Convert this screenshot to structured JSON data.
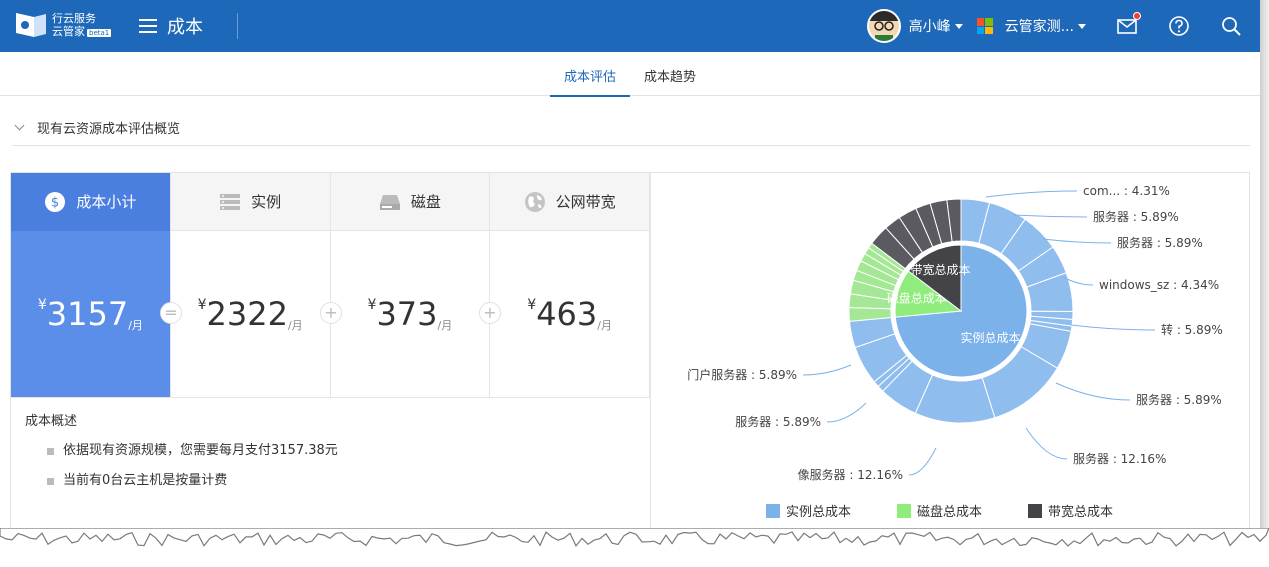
{
  "header": {
    "logo_line1": "行云服务",
    "logo_line2": "云管家",
    "logo_badge": "beta1",
    "page_title": "成本",
    "user_name": "高小峰",
    "tenant_name": "云管家测...",
    "icons": [
      "menu-icon",
      "mail-icon",
      "help-icon",
      "search-icon"
    ]
  },
  "tabs": [
    {
      "label": "成本评估",
      "active": true
    },
    {
      "label": "成本趋势",
      "active": false
    }
  ],
  "section": {
    "title": "现有云资源成本评估概览"
  },
  "metrics": [
    {
      "label": "成本小计",
      "currency": "¥",
      "value": "3157",
      "unit": "/月",
      "icon": "dollar-icon",
      "active": true
    },
    {
      "label": "实例",
      "currency": "¥",
      "value": "2322",
      "unit": "/月",
      "icon": "server-icon",
      "active": false
    },
    {
      "label": "磁盘",
      "currency": "¥",
      "value": "373",
      "unit": "/月",
      "icon": "disk-icon",
      "active": false
    },
    {
      "label": "公网带宽",
      "currency": "¥",
      "value": "463",
      "unit": "/月",
      "icon": "globe-icon",
      "active": false
    }
  ],
  "operators": [
    "=",
    "+",
    "+"
  ],
  "summary": {
    "title": "成本概述",
    "items": [
      "依据现有资源规模，您需要每月支付3157.38元",
      "当前有0台云主机是按量计费"
    ]
  },
  "chart_data": {
    "type": "pie",
    "inner": [
      {
        "name": "实例总成本",
        "value": 2322,
        "color": "#7cb2ea"
      },
      {
        "name": "磁盘总成本",
        "value": 373,
        "color": "#90ed7d"
      },
      {
        "name": "带宽总成本",
        "value": 463,
        "color": "#434348"
      }
    ],
    "outer_labels": [
      {
        "text": "com... : 4.31%"
      },
      {
        "text": "服务器 : 5.89%"
      },
      {
        "text": "服务器 : 5.89%"
      },
      {
        "text": "windows_sz : 4.34%"
      },
      {
        "text": "转 : 5.89%"
      },
      {
        "text": "服务器 : 5.89%"
      },
      {
        "text": "服务器 : 12.16%"
      },
      {
        "text": "像服务器 : 12.16%"
      },
      {
        "text": "服务器 : 5.89%"
      },
      {
        "text": "门户服务器 : 5.89%"
      }
    ],
    "outer_percent": [
      4.31,
      5.89,
      5.89,
      4.34,
      5.89,
      1.2,
      1.0,
      0.8,
      5.89,
      12.16,
      12.16,
      5.89,
      1.0,
      0.9,
      5.89
    ],
    "legend": [
      "实例总成本",
      "磁盘总成本",
      "带宽总成本"
    ],
    "legend_colors": [
      "#7cb2ea",
      "#90ed7d",
      "#434348"
    ]
  }
}
